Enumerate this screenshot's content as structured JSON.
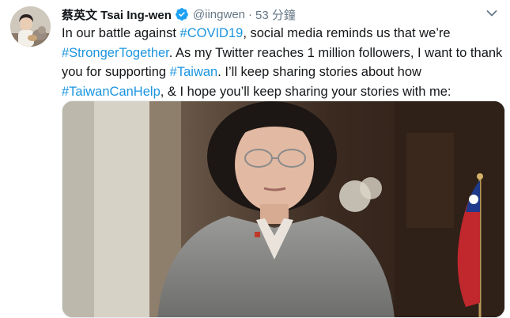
{
  "tweet": {
    "author": {
      "display_name": "蔡英文 Tsai Ing-wen",
      "verified": true,
      "verified_icon": "verified-badge-icon",
      "handle": "@iingwen"
    },
    "separator": "·",
    "timestamp": "53 分鐘",
    "menu_icon": "chevron-down-icon",
    "text": {
      "p1": "In our battle against ",
      "hashtag_covid": "#COVID19",
      "p2": ", social media reminds us that we’re ",
      "hashtag_stronger": "#StrongerTogether",
      "p3": ". As my Twitter reaches 1 million followers, I want to thank you for supporting ",
      "hashtag_taiwan": "#Taiwan",
      "p4": ". I’ll keep sharing stories about how ",
      "hashtag_taiwancanhelp": "#TaiwanCanHelp",
      "p5": ", & I hope you’ll keep sharing your stories with me:"
    },
    "link_color": "#1b95e0",
    "media": {
      "type": "video-thumbnail",
      "description_icon": "video-still-image"
    }
  }
}
